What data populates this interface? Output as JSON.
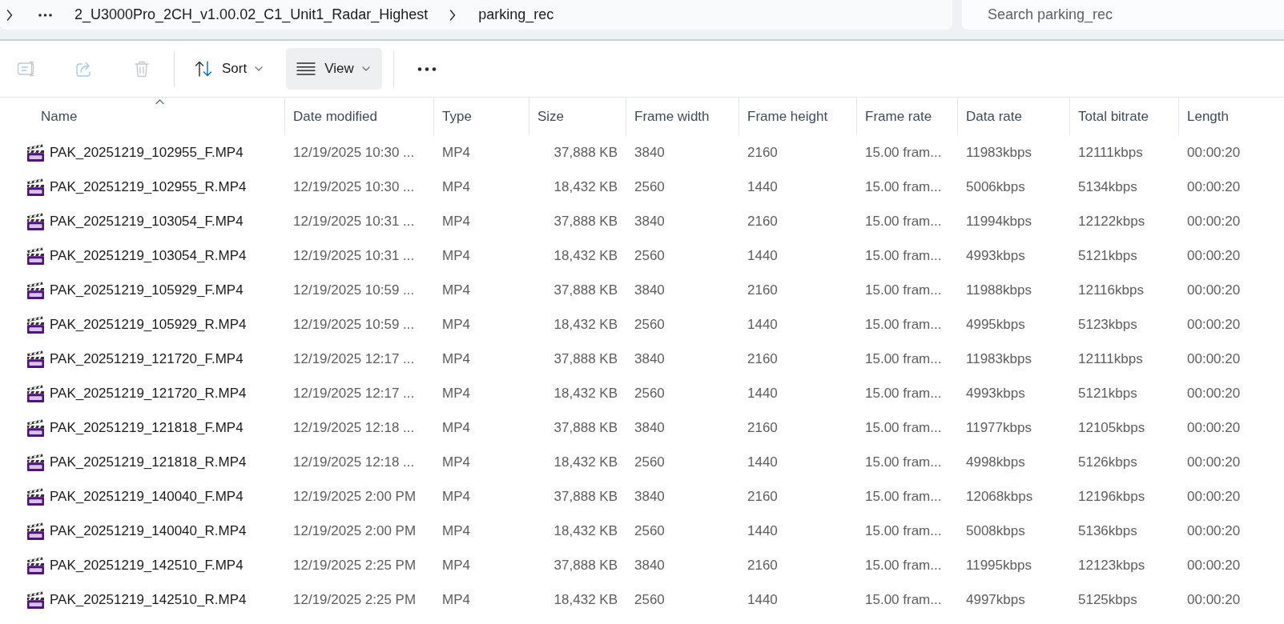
{
  "address_bar": {
    "breadcrumbs": [
      {
        "label": "2_U3000Pro_2CH_v1.00.02_C1_Unit1_Radar_Highest"
      },
      {
        "label": "parking_rec"
      }
    ]
  },
  "search": {
    "placeholder": "Search parking_rec"
  },
  "toolbar": {
    "groups": [
      {
        "buttons": [
          {
            "kind": "rename",
            "disabled": true,
            "hovered": false
          },
          {
            "kind": "share",
            "disabled": true,
            "hovered": false
          },
          {
            "kind": "delete",
            "disabled": true,
            "hovered": false
          }
        ]
      },
      {
        "buttons": [
          {
            "kind": "sort",
            "label": "Sort",
            "disabled": false,
            "hovered": false
          },
          {
            "kind": "view",
            "label": "View",
            "disabled": false,
            "hovered": true
          }
        ]
      },
      {
        "buttons": [
          {
            "kind": "more",
            "disabled": false,
            "hovered": false
          }
        ]
      }
    ]
  },
  "table": {
    "columns": [
      {
        "label": "Name",
        "sorted": true
      },
      {
        "label": "Date modified",
        "sorted": false
      },
      {
        "label": "Type",
        "sorted": false
      },
      {
        "label": "Size",
        "sorted": false
      },
      {
        "label": "Frame width",
        "sorted": false
      },
      {
        "label": "Frame height",
        "sorted": false
      },
      {
        "label": "Frame rate",
        "sorted": false
      },
      {
        "label": "Data rate",
        "sorted": false
      },
      {
        "label": "Total bitrate",
        "sorted": false
      },
      {
        "label": "Length",
        "sorted": false
      }
    ],
    "rows": [
      {
        "cells": [
          "PAK_20251219_102955_F.MP4",
          "12/19/2025 10:30 ...",
          "MP4",
          "37,888 KB",
          "3840",
          "2160",
          "15.00 fram...",
          "11983kbps",
          "12111kbps",
          "00:00:20"
        ]
      },
      {
        "cells": [
          "PAK_20251219_102955_R.MP4",
          "12/19/2025 10:30 ...",
          "MP4",
          "18,432 KB",
          "2560",
          "1440",
          "15.00 fram...",
          "5006kbps",
          "5134kbps",
          "00:00:20"
        ]
      },
      {
        "cells": [
          "PAK_20251219_103054_F.MP4",
          "12/19/2025 10:31 ...",
          "MP4",
          "37,888 KB",
          "3840",
          "2160",
          "15.00 fram...",
          "11994kbps",
          "12122kbps",
          "00:00:20"
        ]
      },
      {
        "cells": [
          "PAK_20251219_103054_R.MP4",
          "12/19/2025 10:31 ...",
          "MP4",
          "18,432 KB",
          "2560",
          "1440",
          "15.00 fram...",
          "4993kbps",
          "5121kbps",
          "00:00:20"
        ]
      },
      {
        "cells": [
          "PAK_20251219_105929_F.MP4",
          "12/19/2025 10:59 ...",
          "MP4",
          "37,888 KB",
          "3840",
          "2160",
          "15.00 fram...",
          "11988kbps",
          "12116kbps",
          "00:00:20"
        ]
      },
      {
        "cells": [
          "PAK_20251219_105929_R.MP4",
          "12/19/2025 10:59 ...",
          "MP4",
          "18,432 KB",
          "2560",
          "1440",
          "15.00 fram...",
          "4995kbps",
          "5123kbps",
          "00:00:20"
        ]
      },
      {
        "cells": [
          "PAK_20251219_121720_F.MP4",
          "12/19/2025 12:17 ...",
          "MP4",
          "37,888 KB",
          "3840",
          "2160",
          "15.00 fram...",
          "11983kbps",
          "12111kbps",
          "00:00:20"
        ]
      },
      {
        "cells": [
          "PAK_20251219_121720_R.MP4",
          "12/19/2025 12:17 ...",
          "MP4",
          "18,432 KB",
          "2560",
          "1440",
          "15.00 fram...",
          "4993kbps",
          "5121kbps",
          "00:00:20"
        ]
      },
      {
        "cells": [
          "PAK_20251219_121818_F.MP4",
          "12/19/2025 12:18 ...",
          "MP4",
          "37,888 KB",
          "3840",
          "2160",
          "15.00 fram...",
          "11977kbps",
          "12105kbps",
          "00:00:20"
        ]
      },
      {
        "cells": [
          "PAK_20251219_121818_R.MP4",
          "12/19/2025 12:18 ...",
          "MP4",
          "18,432 KB",
          "2560",
          "1440",
          "15.00 fram...",
          "4998kbps",
          "5126kbps",
          "00:00:20"
        ]
      },
      {
        "cells": [
          "PAK_20251219_140040_F.MP4",
          "12/19/2025 2:00 PM",
          "MP4",
          "37,888 KB",
          "3840",
          "2160",
          "15.00 fram...",
          "12068kbps",
          "12196kbps",
          "00:00:20"
        ]
      },
      {
        "cells": [
          "PAK_20251219_140040_R.MP4",
          "12/19/2025 2:00 PM",
          "MP4",
          "18,432 KB",
          "2560",
          "1440",
          "15.00 fram...",
          "5008kbps",
          "5136kbps",
          "00:00:20"
        ]
      },
      {
        "cells": [
          "PAK_20251219_142510_F.MP4",
          "12/19/2025 2:25 PM",
          "MP4",
          "37,888 KB",
          "3840",
          "2160",
          "15.00 fram...",
          "11995kbps",
          "12123kbps",
          "00:00:20"
        ]
      },
      {
        "cells": [
          "PAK_20251219_142510_R.MP4",
          "12/19/2025 2:25 PM",
          "MP4",
          "18,432 KB",
          "2560",
          "1440",
          "15.00 fram...",
          "4997kbps",
          "5125kbps",
          "00:00:20"
        ]
      }
    ]
  }
}
